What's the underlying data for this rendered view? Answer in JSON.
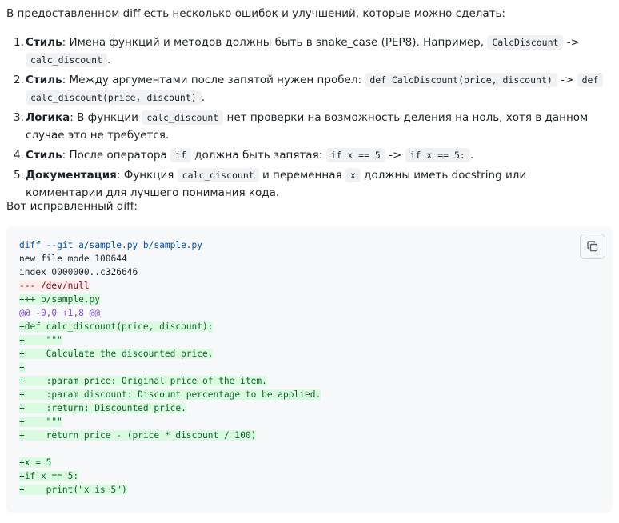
{
  "intro": "В предоставленном diff есть несколько ошибок и улучшений, которые можно сделать:",
  "items": [
    {
      "n": "1.",
      "label": "Стиль",
      "t1": ": Имена функций и методов должны быть в snake_case (PEP8). Например, ",
      "c1": "CalcDiscount",
      "t2": " -> ",
      "c2": "calc_discount",
      "t3": "."
    },
    {
      "n": "2.",
      "label": "Стиль",
      "t1": ": Между аргументами после запятой нужен пробел: ",
      "c1": "def CalcDiscount(price, discount)",
      "t2": " -> ",
      "c2a": "def",
      "c2b": "calc_discount(price, discount)",
      "t3": "."
    },
    {
      "n": "3.",
      "label": "Логика",
      "t1": ": В функции ",
      "c1": "calc_discount",
      "t2": " нет проверки на возможность деления на ноль, хотя в данном случае это не требуется."
    },
    {
      "n": "4.",
      "label": "Стиль",
      "t1": ": После оператора ",
      "c1": "if",
      "t2": " должна быть запятая: ",
      "c2": "if x == 5",
      "t3": " -> ",
      "c3": "if x == 5:",
      "t4": "."
    },
    {
      "n": "5.",
      "label": "Документация",
      "t1": ": Функция ",
      "c1": "calc_discount",
      "t2": " и переменная ",
      "c2": "x",
      "t3": " должны иметь docstring или комментарии для лучшего понимания кода."
    }
  ],
  "outro": "Вот исправленный diff:",
  "copy_icon": "copy-icon",
  "diff_lines": [
    {
      "kind": "meta",
      "text": "diff --git a/sample.py b/sample.py"
    },
    {
      "kind": "plain",
      "text": "new file mode 100644"
    },
    {
      "kind": "plain",
      "text": "index 0000000..c326646"
    },
    {
      "kind": "del",
      "text": "--- /dev/null"
    },
    {
      "kind": "ins",
      "text": "+++ b/sample.py"
    },
    {
      "kind": "hunk",
      "text": "@@ -0,0 +1,8 @@"
    },
    {
      "kind": "ins",
      "text": "+def calc_discount(price, discount):"
    },
    {
      "kind": "ins",
      "text": "+    \"\"\""
    },
    {
      "kind": "ins",
      "text": "+    Calculate the discounted price."
    },
    {
      "kind": "ins",
      "text": "+"
    },
    {
      "kind": "ins",
      "text": "+    :param price: Original price of the item."
    },
    {
      "kind": "ins",
      "text": "+    :param discount: Discount percentage to be applied."
    },
    {
      "kind": "ins",
      "text": "+    :return: Discounted price."
    },
    {
      "kind": "ins",
      "text": "+    \"\"\""
    },
    {
      "kind": "ins",
      "text": "+    return price - (price * discount / 100)"
    },
    {
      "kind": "plain",
      "text": ""
    },
    {
      "kind": "ins",
      "text": "+x = 5"
    },
    {
      "kind": "ins",
      "text": "+if x == 5:"
    },
    {
      "kind": "ins",
      "text": "+    print(\"x is 5\")"
    }
  ]
}
